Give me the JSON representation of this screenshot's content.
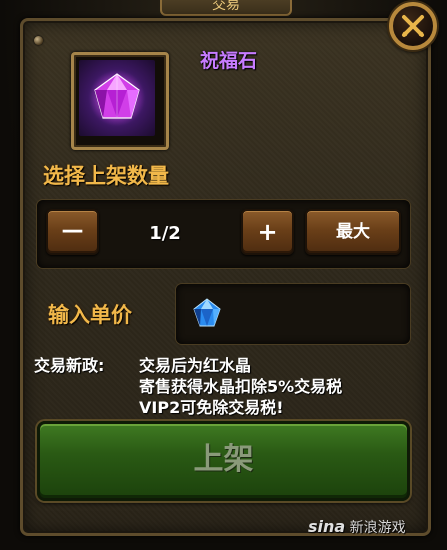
{
  "dialog": {
    "tab_title": "交易"
  },
  "item": {
    "name": "祝福石",
    "icon": "purple-gem-icon"
  },
  "quantity": {
    "label": "选择上架数量",
    "decrement_label": "—",
    "value": "1/2",
    "increment_label": "+",
    "max_label": "最大"
  },
  "price": {
    "label": "输入单价",
    "icon": "blue-crystal-icon",
    "value": ""
  },
  "notice": {
    "prefix": "交易新政:",
    "line1": "交易后为红水晶",
    "line2": "寄售获得水晶扣除5%交易税",
    "line3": "VIP2可免除交易税!"
  },
  "actions": {
    "list_label": "上架"
  },
  "watermark": {
    "logo": "sina",
    "text": "新浪游戏"
  },
  "colors": {
    "item_name": "#c77cff",
    "section_label": "#f2b84a",
    "list_button": "#2a5a14"
  }
}
